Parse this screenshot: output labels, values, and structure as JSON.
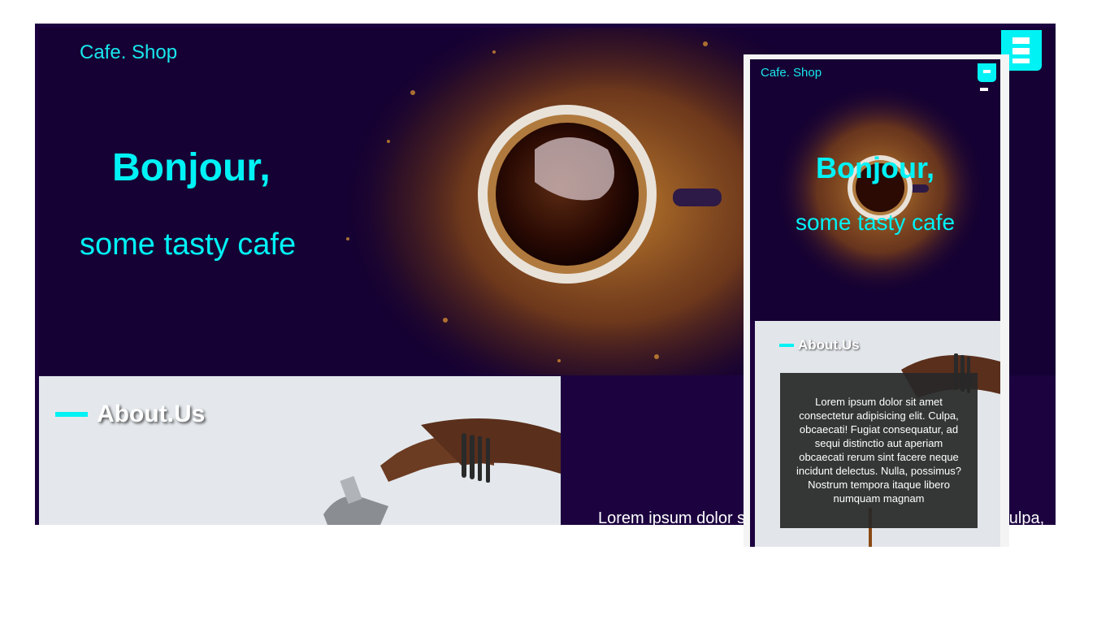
{
  "desktop": {
    "logo": "Cafe. Shop",
    "hero_title": "Bonjour,",
    "hero_subtitle": "some tasty cafe",
    "about_title": "About.Us",
    "about_text": "Lorem ipsum dolor sit amet consectetur adipisicing elit. Culpa,",
    "menu_icon": "menu-icon"
  },
  "mobile": {
    "logo": "Cafe. Shop",
    "hero_title": "Bonjour,",
    "hero_subtitle": "some tasty cafe",
    "about_title": "About.Us",
    "about_text": "Lorem ipsum dolor sit amet consectetur adipisicing elit. Culpa, obcaecati! Fugiat consequatur, ad sequi distinctio aut aperiam obcaecati rerum sint facere neque incidunt delectus. Nulla, possimus? Nostrum tempora itaque libero numquam magnam",
    "menu_icon": "menu-icon"
  },
  "colors": {
    "accent": "#00f2f5",
    "background": "#1c0340",
    "hero_background": "#150133"
  }
}
